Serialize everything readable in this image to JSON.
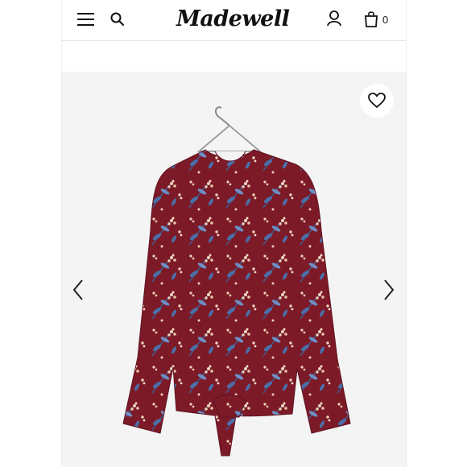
{
  "header": {
    "brand": "Madewell",
    "bag_count": "0",
    "icons": [
      "menu-icon",
      "search-icon",
      "account-icon",
      "bag-icon"
    ]
  },
  "gallery": {
    "product_image": "floral-print-tie-front-blouse-image",
    "icons": [
      "heart-icon",
      "chevron-left-icon",
      "chevron-right-icon"
    ]
  },
  "colors": {
    "blouse_base": "#7d1a28",
    "leaf_blue": "#4b6fa8",
    "blossom_cream": "#f0d3b8",
    "gallery_bg": "#f4f4f4"
  }
}
